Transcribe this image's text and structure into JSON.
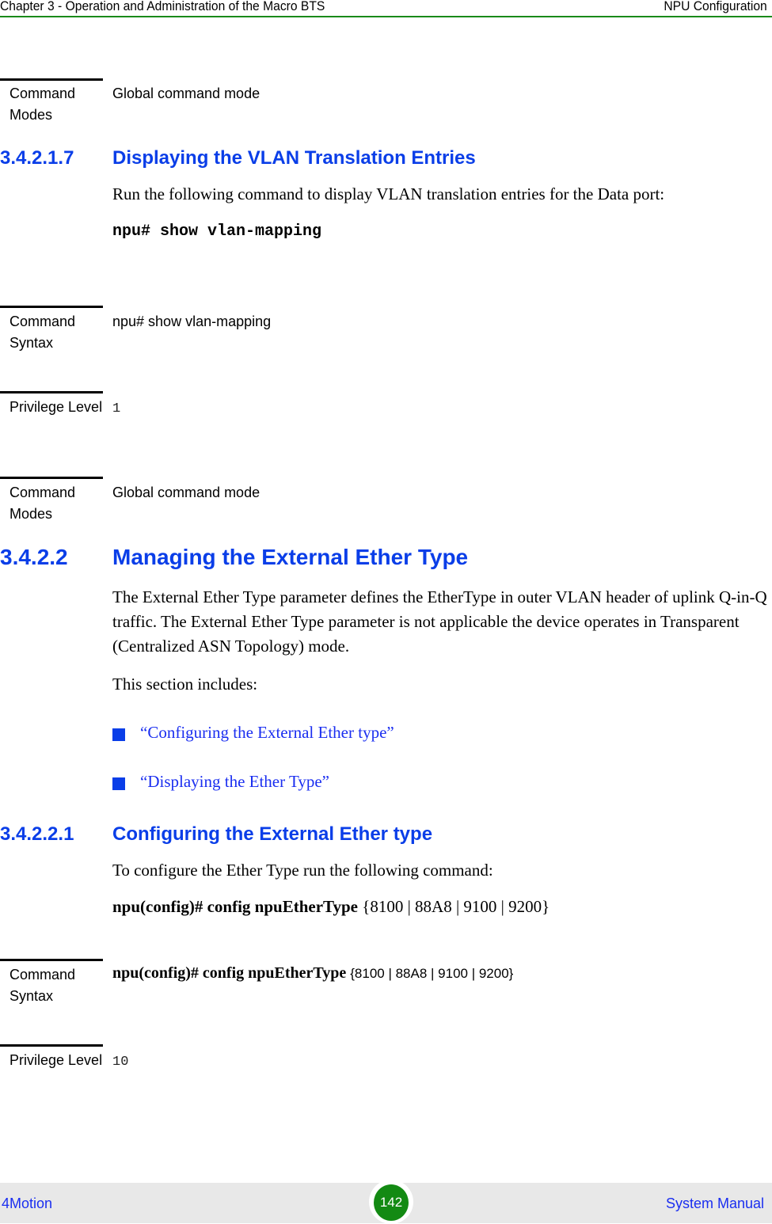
{
  "header": {
    "chapter": "Chapter 3 - Operation and Administration of the Macro BTS",
    "section": "NPU Configuration"
  },
  "blocks": {
    "modes1": {
      "label": "Command Modes",
      "value": "Global command mode"
    },
    "section_3421_7": {
      "number": "3.4.2.1.7",
      "title": "Displaying the VLAN Translation Entries",
      "intro": "Run the following command to display VLAN translation entries for the Data port:",
      "command": "npu# show vlan-mapping"
    },
    "syntax1": {
      "label": "Command Syntax",
      "value": "npu# show vlan-mapping"
    },
    "privilege1": {
      "label": "Privilege Level",
      "value": "1"
    },
    "modes2": {
      "label": "Command Modes",
      "value": "Global command mode"
    },
    "section_3422": {
      "number": "3.4.2.2",
      "title": "Managing the External Ether Type",
      "paragraph": "The External Ether Type parameter defines the EtherType in outer VLAN header of uplink Q-in-Q traffic. The External Ether Type parameter is not applicable the device operates in Transparent (Centralized ASN Topology) mode.",
      "includes": "This section includes:",
      "links": [
        "“Configuring the External Ether type”",
        "“Displaying the Ether Type”"
      ]
    },
    "section_34221": {
      "number": "3.4.2.2.1",
      "title": "Configuring the External Ether type",
      "intro": "To configure the Ether Type run the following command:",
      "command_bold": "npu(config)# config npuEtherType",
      "command_args": "{8100 | 88A8 | 9100 | 9200}"
    },
    "syntax2": {
      "label": "Command Syntax",
      "value_bold": "npu(config)# config npuEtherType",
      "value_args": "{8100 | 88A8 | 9100 | 9200}"
    },
    "privilege2": {
      "label": "Privilege Level",
      "value": "10"
    }
  },
  "footer": {
    "product": "4Motion",
    "page": "142",
    "manual": "System Manual"
  }
}
